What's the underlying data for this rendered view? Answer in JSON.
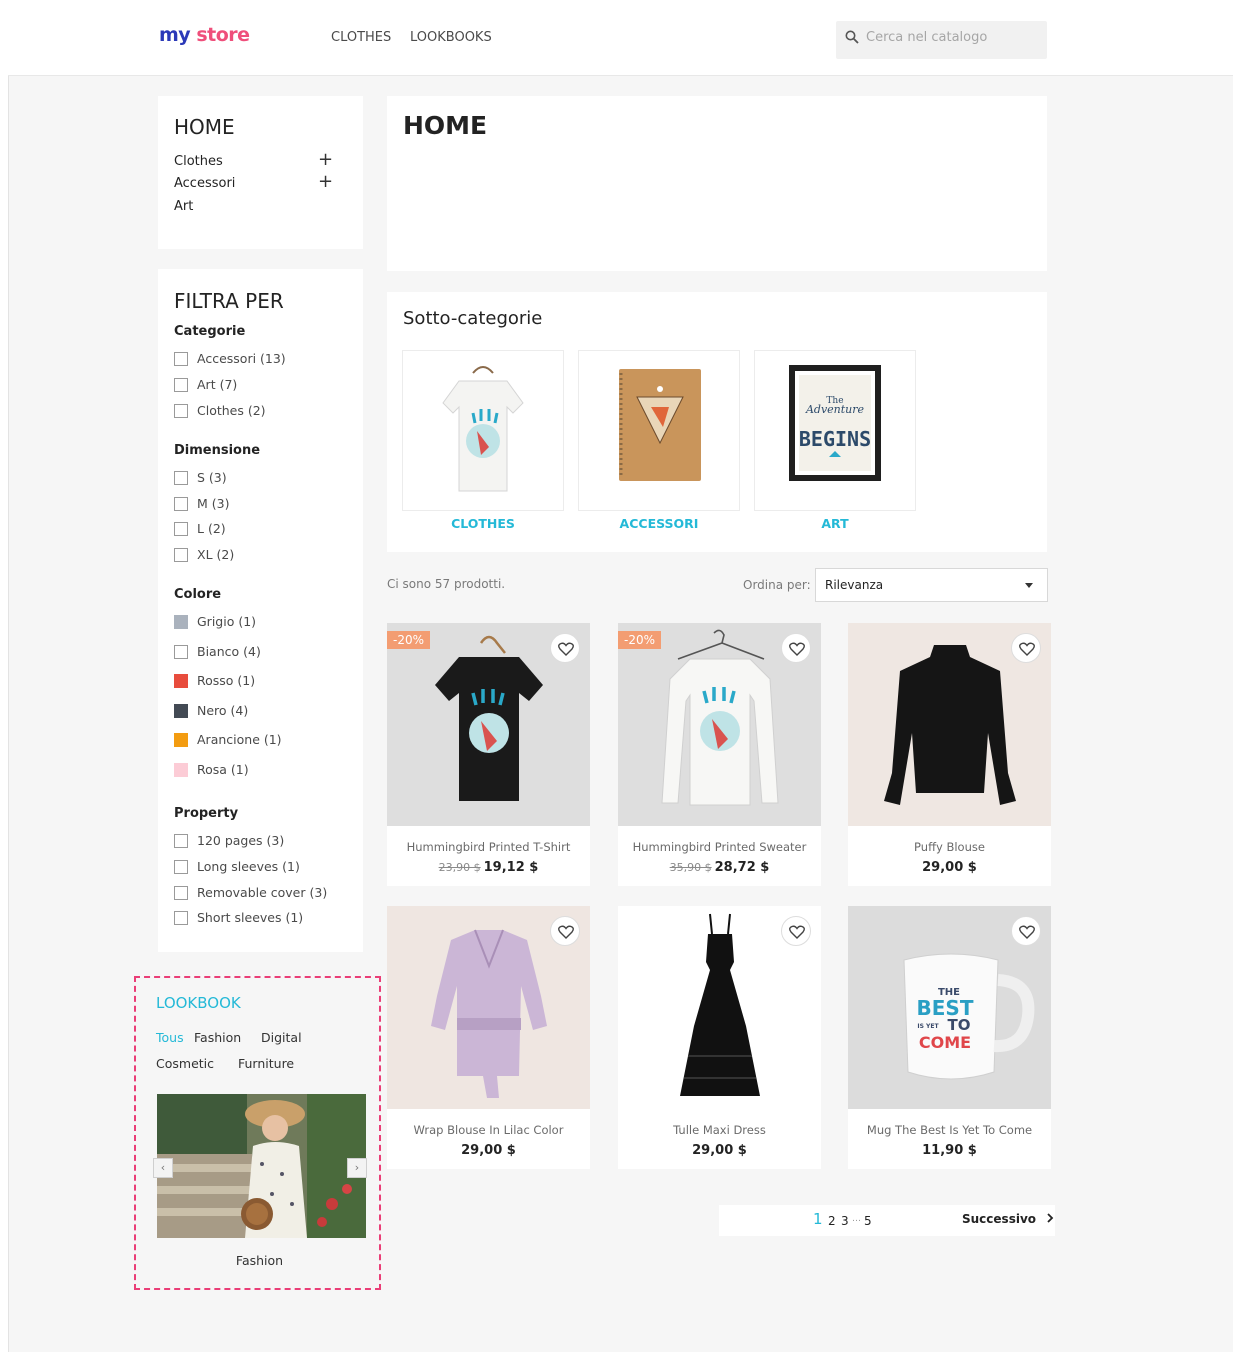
{
  "header": {
    "logo_part1": "my",
    "logo_part2": "store",
    "nav": [
      "CLOTHES",
      "LOOKBOOKS"
    ],
    "search_placeholder": "Cerca nel catalogo"
  },
  "category_block": {
    "title": "HOME",
    "items": [
      "Clothes",
      "Accessori",
      "Art"
    ],
    "expand_symbol": "+"
  },
  "filters": {
    "title": "FILTRA PER",
    "sections": [
      {
        "name": "Categorie",
        "items": [
          "Accessori (13)",
          "Art (7)",
          "Clothes (2)"
        ]
      },
      {
        "name": "Dimensione",
        "items": [
          "S (3)",
          "M (3)",
          "L (2)",
          "XL (2)"
        ]
      },
      {
        "name": "Colore",
        "items": [
          {
            "label": "Grigio (1)",
            "color": "#aab2bd"
          },
          {
            "label": "Bianco (4)",
            "color": "#ffffff"
          },
          {
            "label": "Rosso (1)",
            "color": "#e84c3d"
          },
          {
            "label": "Nero (4)",
            "color": "#434a54"
          },
          {
            "label": "Arancione (1)",
            "color": "#f39c11"
          },
          {
            "label": "Rosa (1)",
            "color": "#fcccd6"
          }
        ]
      },
      {
        "name": "Property",
        "items": [
          "120 pages (3)",
          "Long sleeves (1)",
          "Removable cover (3)",
          "Short sleeves (1)"
        ]
      }
    ]
  },
  "lookbook": {
    "title": "LOOKBOOK",
    "tabs": [
      "Tous",
      "Fashion",
      "Digital",
      "Cosmetic",
      "Furniture"
    ],
    "active_tab": "Tous",
    "caption": "Fashion",
    "prev": "‹",
    "next": "›"
  },
  "main": {
    "title": "HOME",
    "subcategories_title": "Sotto-categorie",
    "subcategories": [
      "CLOTHES",
      "ACCESSORI",
      "ART"
    ],
    "poster_text": {
      "line1": "The",
      "line2": "Adventure",
      "line3": "BEGINS"
    },
    "product_count": "Ci sono 57 prodotti.",
    "sort_label": "Ordina per:",
    "sort_value": "Rilevanza"
  },
  "products": [
    {
      "name": "Hummingbird Printed T-Shirt",
      "old_price": "23,90 $",
      "price": "19,12 $",
      "badge": "-20%"
    },
    {
      "name": "Hummingbird Printed Sweater",
      "old_price": "35,90 $",
      "price": "28,72 $",
      "badge": "-20%"
    },
    {
      "name": "Puffy Blouse",
      "price": "29,00 $"
    },
    {
      "name": "Wrap Blouse In Lilac Color",
      "price": "29,00 $"
    },
    {
      "name": "Tulle Maxi Dress",
      "price": "29,00 $"
    },
    {
      "name": "Mug The Best Is Yet To Come",
      "price": "11,90 $"
    }
  ],
  "mug_text": {
    "line1": "THE",
    "line2": "BEST",
    "line3": "IS YET",
    "line4": "TO",
    "line5": "COME"
  },
  "pagination": {
    "pages": [
      "1",
      "2",
      "3",
      "…",
      "5"
    ],
    "current": "1",
    "next_label": "Successivo"
  },
  "colors": {
    "accent": "#24b9d7",
    "badge": "#f39d72",
    "highlight_border": "#ea3e77"
  }
}
